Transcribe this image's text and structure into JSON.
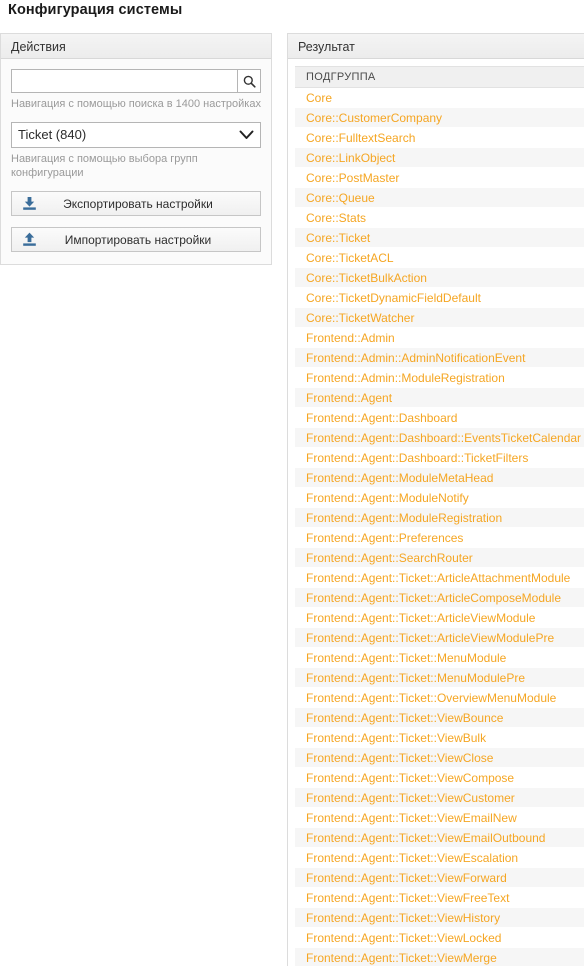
{
  "page": {
    "title": "Конфигурация системы"
  },
  "actions": {
    "header": "Действия",
    "search": {
      "value": "",
      "placeholder": "",
      "icon": "search-icon",
      "hint": "Навигация с помощью поиска в 1400 настройках"
    },
    "group_select": {
      "selected": "Ticket (840)",
      "options": [
        "Ticket (840)"
      ],
      "icon": "chevron-down-icon",
      "hint": "Навигация с помощью выбора групп конфигурации"
    },
    "export_button": {
      "label": "Экспортировать настройки",
      "icon": "download-icon"
    },
    "import_button": {
      "label": "Импортировать настройки",
      "icon": "upload-icon"
    }
  },
  "result": {
    "header": "Результат",
    "column_header": "ПОДГРУППА",
    "link_color": "#f5a623",
    "items": [
      "Core",
      "Core::CustomerCompany",
      "Core::FulltextSearch",
      "Core::LinkObject",
      "Core::PostMaster",
      "Core::Queue",
      "Core::Stats",
      "Core::Ticket",
      "Core::TicketACL",
      "Core::TicketBulkAction",
      "Core::TicketDynamicFieldDefault",
      "Core::TicketWatcher",
      "Frontend::Admin",
      "Frontend::Admin::AdminNotificationEvent",
      "Frontend::Admin::ModuleRegistration",
      "Frontend::Agent",
      "Frontend::Agent::Dashboard",
      "Frontend::Agent::Dashboard::EventsTicketCalendar",
      "Frontend::Agent::Dashboard::TicketFilters",
      "Frontend::Agent::ModuleMetaHead",
      "Frontend::Agent::ModuleNotify",
      "Frontend::Agent::ModuleRegistration",
      "Frontend::Agent::Preferences",
      "Frontend::Agent::SearchRouter",
      "Frontend::Agent::Ticket::ArticleAttachmentModule",
      "Frontend::Agent::Ticket::ArticleComposeModule",
      "Frontend::Agent::Ticket::ArticleViewModule",
      "Frontend::Agent::Ticket::ArticleViewModulePre",
      "Frontend::Agent::Ticket::MenuModule",
      "Frontend::Agent::Ticket::MenuModulePre",
      "Frontend::Agent::Ticket::OverviewMenuModule",
      "Frontend::Agent::Ticket::ViewBounce",
      "Frontend::Agent::Ticket::ViewBulk",
      "Frontend::Agent::Ticket::ViewClose",
      "Frontend::Agent::Ticket::ViewCompose",
      "Frontend::Agent::Ticket::ViewCustomer",
      "Frontend::Agent::Ticket::ViewEmailNew",
      "Frontend::Agent::Ticket::ViewEmailOutbound",
      "Frontend::Agent::Ticket::ViewEscalation",
      "Frontend::Agent::Ticket::ViewForward",
      "Frontend::Agent::Ticket::ViewFreeText",
      "Frontend::Agent::Ticket::ViewHistory",
      "Frontend::Agent::Ticket::ViewLocked",
      "Frontend::Agent::Ticket::ViewMerge"
    ]
  }
}
